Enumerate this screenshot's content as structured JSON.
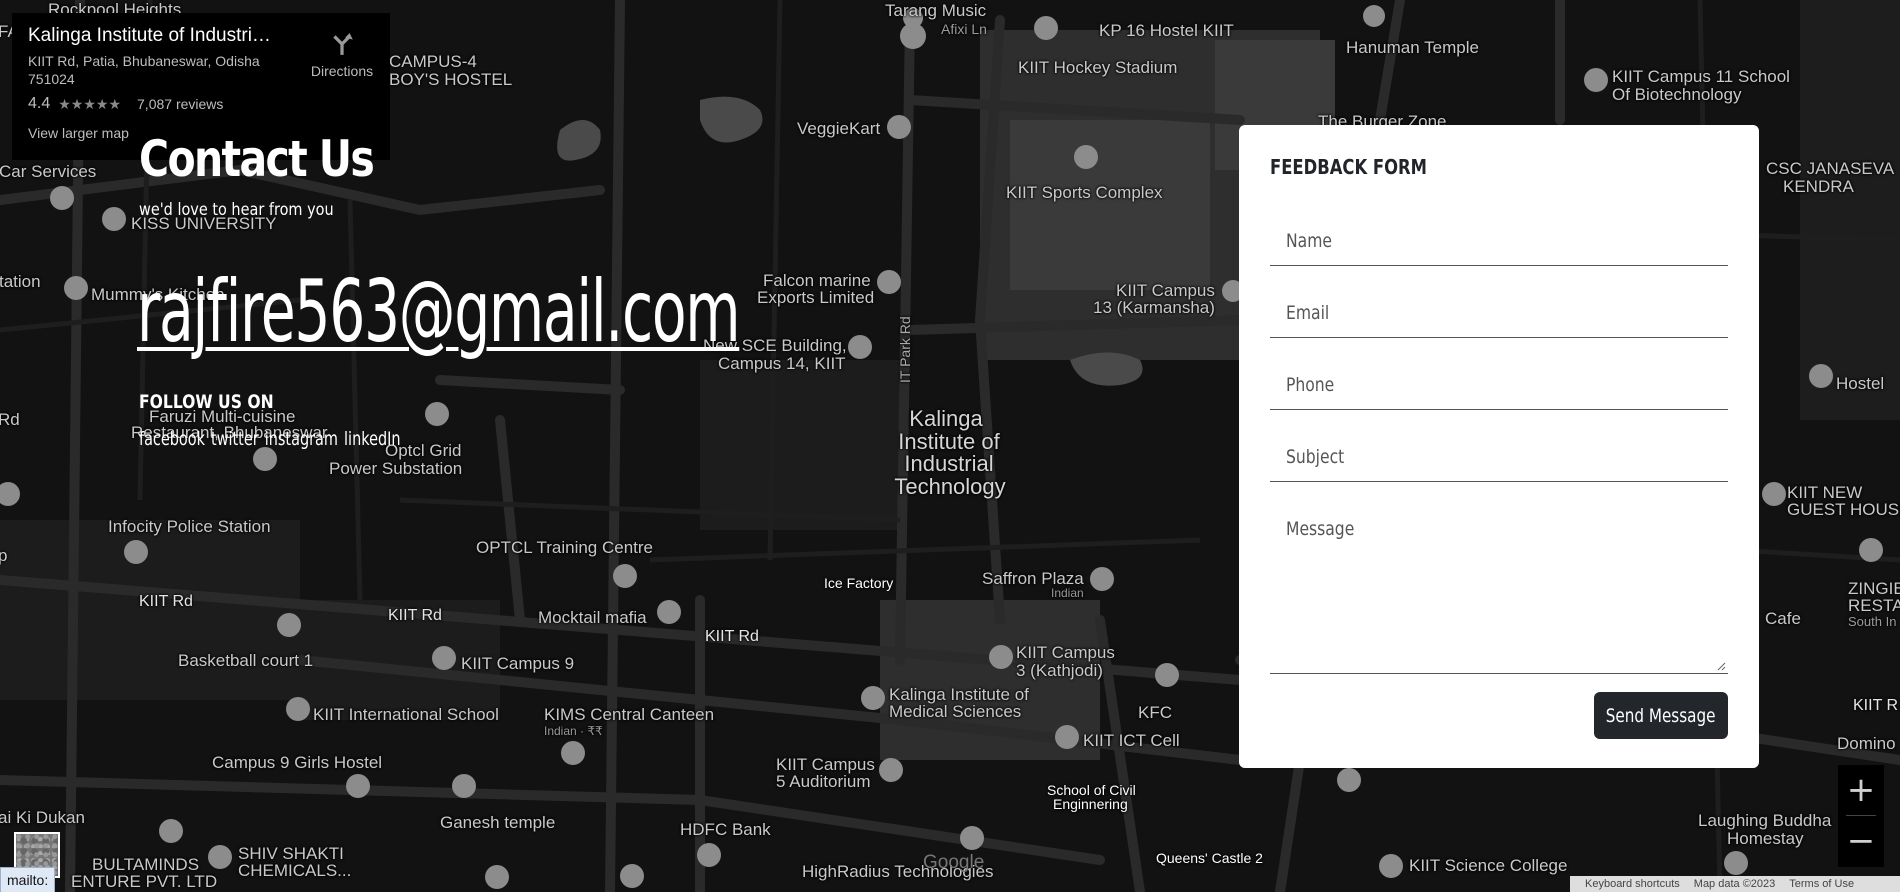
{
  "info_card": {
    "title": "Kalinga Institute of Industrial ...",
    "address": "KIIT Rd, Patia, Bhubaneswar, Odisha 751024",
    "rating": "4.4",
    "stars": "★★★★★",
    "reviews": "7,087 reviews",
    "view_larger": "View larger map",
    "directions": "Directions"
  },
  "hero": {
    "title": "Contact Us",
    "subtitle": "we'd love to hear from you",
    "email": "rajfire563@gmail.com",
    "follow_title": "FOLLOW US ON",
    "social": [
      "facebook",
      "twitter",
      "instagram",
      "linkedIn"
    ]
  },
  "form": {
    "title": "FEEDBACK FORM",
    "name_placeholder": "Name",
    "email_placeholder": "Email",
    "phone_placeholder": "Phone",
    "subject_placeholder": "Subject",
    "message_placeholder": "Message",
    "send_label": "Send Message"
  },
  "map": {
    "labels": {
      "rockpool": "Rockpool Heights",
      "campus4": "CAMPUS-4",
      "boys_hostel": "BOY'S HOSTEL",
      "tarang": "Tarang Music",
      "afixi": "Afixi Ln",
      "kp16": "KP 16 Hostel KIIT",
      "hockey": "KIIT Hockey Stadium",
      "hanuman": "Hanuman Temple",
      "campus11": "KIIT Campus 11 School",
      "biotech": "Of Biotechnology",
      "burger": "The Burger Zone",
      "veggiekart": "VeggieKart",
      "sports": "KIIT Sports Complex",
      "csc1": "CSC JANASEVA",
      "csc2": "KENDRA",
      "car_services": "Car Services",
      "kiss": "KISS UNIVERSITY",
      "falcon1": "Falcon marine",
      "falcon2": "Exports Limited",
      "campus13a": "KIIT Campus",
      "campus13b": "13 (Karmansha)",
      "mummy": "Mummy's Kitchen",
      "station": "tation",
      "newbuild1": "New SCE Building,",
      "newbuild2": "Campus 14, KIIT",
      "itpark": "IT Park Rd",
      "kalinga1": "Kalinga",
      "kalinga2": "Institute of",
      "kalinga3": "Industrial",
      "kalinga4": "Technology",
      "hostel": "Hostel",
      "faruzi1": "Faruzi Multi-cuisine",
      "faruzi2": "Restaurant, Bhubaneswar",
      "optcl1": "Optcl Grid",
      "optcl2": "Power Substation",
      "kiit_new1": "KIIT NEW",
      "kiit_new2": "GUEST HOUSE",
      "infocity": "Infocity Police Station",
      "optcl_training": "OPTCL Training Centre",
      "icefactory": "Ice Factory",
      "saffron": "Saffron Plaza",
      "saffron_type": "Indian",
      "zingib1": "ZINGIB",
      "zingib2": "RESTA",
      "zingib3": "South In",
      "cafe": "Cafe",
      "kiitrd1": "KIIT Rd",
      "kiitrd2": "KIIT Rd",
      "kiitrd3": "KIIT Rd",
      "kiitrd4": "KIIT R",
      "mocktail": "Mocktail mafia",
      "basketball": "Basketball court 1",
      "campus9": "KIIT Campus 9",
      "campus3a": "KIIT Campus",
      "campus3b": "3 (Kathjodi)",
      "intl_school": "KIIT International School",
      "kims_canteen": "KIMS Central Canteen",
      "kims_type": "Indian · ₹₹",
      "kims1": "Kalinga Institute of",
      "kims2": "Medical Sciences",
      "kfc": "KFC",
      "ict": "KIIT ICT Cell",
      "domino": "Domino",
      "girls_hostel": "Campus 9 Girls Hostel",
      "campus5a": "KIIT Campus",
      "campus5b": "5 Auditorium",
      "civil1": "School of Civil",
      "civil2": "Enginnering",
      "laughing1": "Laughing Buddha",
      "laughing2": "Homestay",
      "dukan": "ai Ki Dukan",
      "ganesh": "Ganesh temple",
      "hdfc": "HDFC Bank",
      "bultaminds1": "BULTAMINDS",
      "bultaminds2": "ENTURE PVT. LTD",
      "shivshakti1": "SHIV SHAKTI",
      "shivshakti2": "CHEMICALS...",
      "highradius": "HighRadius Technologies",
      "queens": "Queens' Castle 2",
      "science_college": "KIIT Science College",
      "fa": "FA",
      "rd": "Rd",
      "p": "p"
    },
    "google": "Google",
    "keyboard": "Keyboard shortcuts",
    "mapdata": "Map data ©2023",
    "terms": "Terms of Use",
    "zoom_in": "+",
    "zoom_out": "−"
  },
  "status_bar": "mailto:",
  "colors": {
    "background": "#111111",
    "road": "#2c2c2c",
    "block": "#333333",
    "pin": "#8c8c8c",
    "form_bg": "#ffffff",
    "button_bg": "#23262b"
  }
}
